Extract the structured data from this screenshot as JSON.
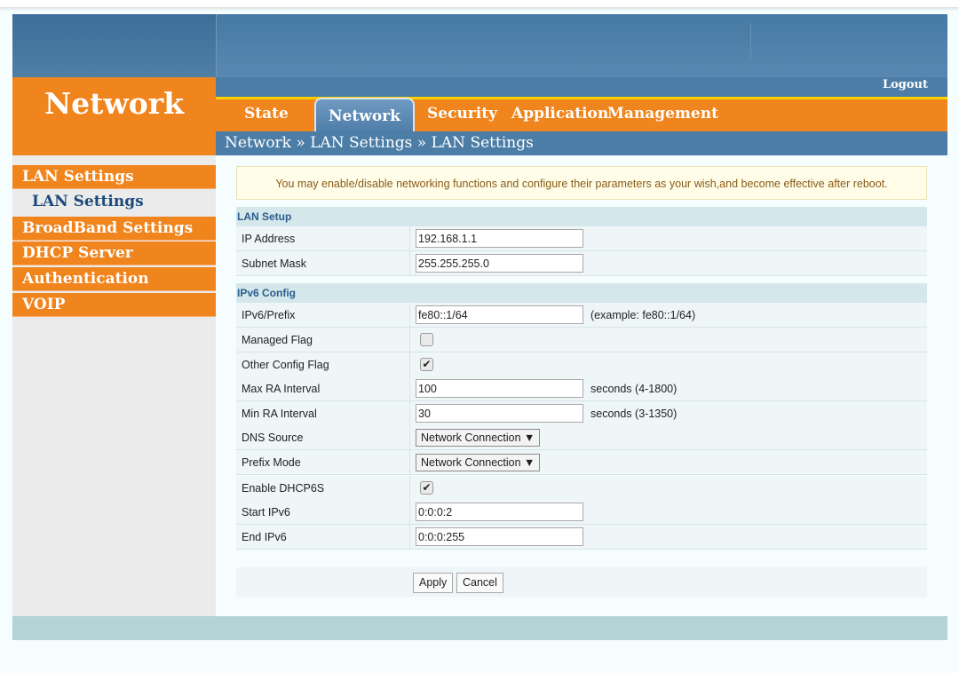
{
  "brand": {
    "title": "Network"
  },
  "header": {
    "logout": "Logout"
  },
  "tabs": [
    {
      "label": "State"
    },
    {
      "label": "Network",
      "active": true
    },
    {
      "label": "Security"
    },
    {
      "label": "Application"
    },
    {
      "label": "Management"
    }
  ],
  "breadcrumb": "Network » LAN Settings » LAN Settings",
  "sidebar": {
    "items": [
      {
        "label": "LAN Settings"
      },
      {
        "label": "BroadBand Settings"
      },
      {
        "label": "DHCP Server"
      },
      {
        "label": "Authentication"
      },
      {
        "label": "VOIP"
      }
    ],
    "sub_items": [
      {
        "label": "LAN Settings"
      }
    ]
  },
  "notice": "You may enable/disable networking functions and configure their parameters as your wish,and become effective after reboot.",
  "lan_setup": {
    "title": "LAN Setup",
    "ip_address": {
      "label": "IP Address",
      "value": "192.168.1.1"
    },
    "subnet_mask": {
      "label": "Subnet Mask",
      "value": "255.255.255.0"
    }
  },
  "ipv6_config": {
    "title": "IPv6 Config",
    "prefix": {
      "label": "IPv6/Prefix",
      "value": "fe80::1/64",
      "hint": "(example: fe80::1/64)"
    },
    "managed_flag": {
      "label": "Managed Flag",
      "checked": false,
      "mark": ""
    },
    "other_config_flag": {
      "label": "Other Config Flag",
      "checked": true,
      "mark": "✔"
    },
    "max_ra": {
      "label": "Max RA Interval",
      "value": "100",
      "hint": "seconds (4-1800)"
    },
    "min_ra": {
      "label": "Min RA Interval",
      "value": "30",
      "hint": "seconds (3-1350)"
    },
    "dns_source": {
      "label": "DNS Source",
      "value": "Network Connection ▼"
    },
    "prefix_mode": {
      "label": "Prefix Mode",
      "value": "Network Connection ▼"
    },
    "enable_dhcp6s": {
      "label": "Enable DHCP6S",
      "checked": true,
      "mark": "✔"
    },
    "start_ipv6": {
      "label": "Start IPv6",
      "value": "0:0:0:2"
    },
    "end_ipv6": {
      "label": "End IPv6",
      "value": "0:0:0:255"
    }
  },
  "buttons": {
    "apply": "Apply",
    "cancel": "Cancel"
  }
}
